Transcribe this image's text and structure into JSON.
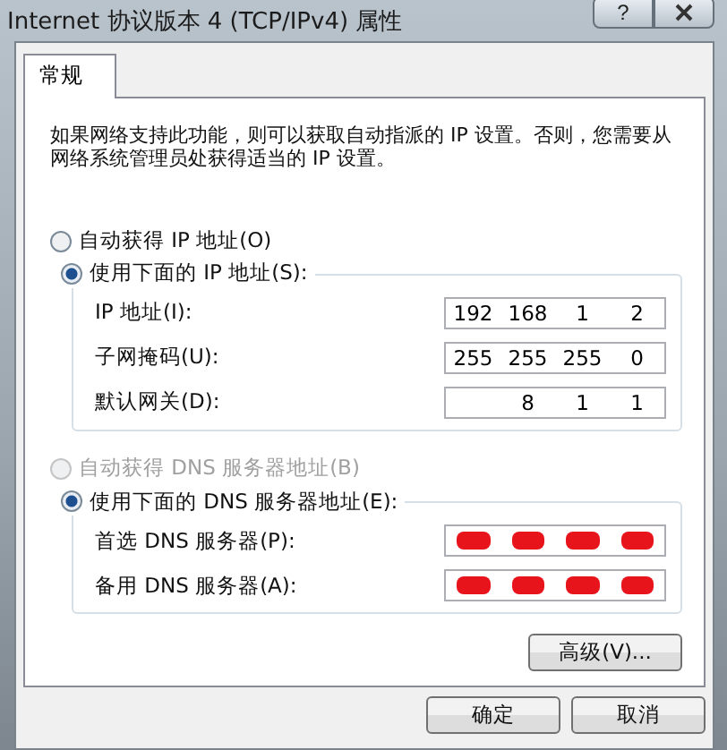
{
  "window": {
    "title": "Internet 协议版本 4 (TCP/IPv4) 属性",
    "help_button": "?"
  },
  "tabs": [
    {
      "label": "常规",
      "selected": true
    }
  ],
  "description": "如果网络支持此功能，则可以获取自动指派的 IP 设置。否则，您需要从网络系统管理员处获得适当的 IP 设置。",
  "ip_options": [
    {
      "label": "自动获得 IP 地址(O)",
      "selected": false,
      "disabled": false
    },
    {
      "label": "使用下面的 IP 地址(S):",
      "selected": true,
      "disabled": false
    }
  ],
  "ip_fields": [
    {
      "label": "IP 地址(I):",
      "octets": [
        "192",
        "168",
        "1",
        "2"
      ]
    },
    {
      "label": "子网掩码(U):",
      "octets": [
        "255",
        "255",
        "255",
        "0"
      ]
    },
    {
      "label": "默认网关(D):",
      "octets": [
        "8",
        "1",
        "1"
      ]
    }
  ],
  "dns_options": [
    {
      "label": "自动获得 DNS 服务器地址(B)",
      "selected": false,
      "disabled": true
    },
    {
      "label": "使用下面的 DNS 服务器地址(E):",
      "selected": true,
      "disabled": false
    }
  ],
  "dns_fields": [
    {
      "label": "首选 DNS 服务器(P):",
      "redacted": true
    },
    {
      "label": "备用 DNS 服务器(A):",
      "redacted": true
    }
  ],
  "advanced_button": "高级(V)...",
  "buttons": [
    {
      "label": "确定"
    },
    {
      "label": "取消"
    }
  ]
}
